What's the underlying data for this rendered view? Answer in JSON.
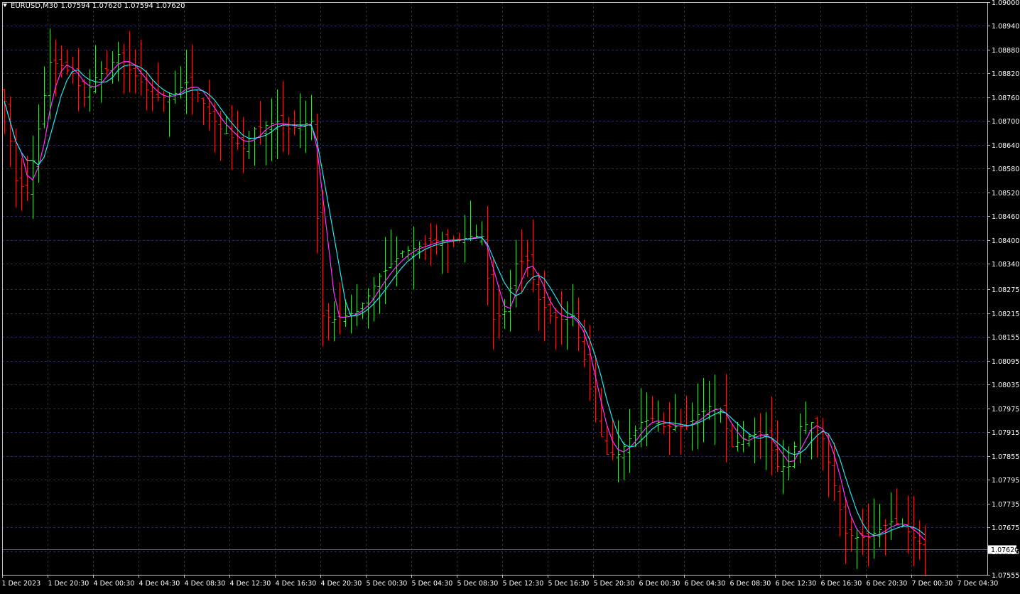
{
  "header": {
    "symbol": "EURUSD,M30",
    "quotes": "1.07594 1.07620 1.07594 1.07620"
  },
  "colors": {
    "background": "#000000",
    "grid": "#1e2a78",
    "frame": "#c0c0c0",
    "axis_text": "#ffffff",
    "bull": "#3fd73f",
    "bear": "#e02020",
    "ma_fast": "#ff33ff",
    "ma_slow": "#22e6f0",
    "price_line": "#5a5a5a"
  },
  "chart_data": {
    "type": "ohlc",
    "symbol": "EURUSD",
    "timeframe": "M30",
    "last_price_label": "1.07620",
    "ylim": [
      1.07555,
      1.09
    ],
    "y_ticks": [
      "1.09000",
      "1.08940",
      "1.08880",
      "1.08820",
      "1.08760",
      "1.08700",
      "1.08640",
      "1.08580",
      "1.08520",
      "1.08460",
      "1.08400",
      "1.08340",
      "1.08275",
      "1.08215",
      "1.08155",
      "1.08095",
      "1.08035",
      "1.07975",
      "1.07915",
      "1.07855",
      "1.07795",
      "1.07735",
      "1.07675",
      "1.07615",
      "1.07555"
    ],
    "x_labels": [
      "1 Dec 2023",
      "1 Dec 20:30",
      "4 Dec 00:30",
      "4 Dec 04:30",
      "4 Dec 08:30",
      "4 Dec 12:30",
      "4 Dec 16:30",
      "4 Dec 20:30",
      "5 Dec 00:30",
      "5 Dec 04:30",
      "5 Dec 08:30",
      "5 Dec 12:30",
      "5 Dec 16:30",
      "5 Dec 20:30",
      "6 Dec 00:30",
      "6 Dec 04:30",
      "6 Dec 08:30",
      "6 Dec 12:30",
      "6 Dec 16:30",
      "6 Dec 20:30",
      "7 Dec 00:30",
      "7 Dec 04:30"
    ],
    "bars_per_label": 8,
    "grid": true,
    "indicators": [
      "MA fast (magenta)",
      "MA slow (cyan)"
    ],
    "anchor_closes": [
      1.0875,
      1.0855,
      1.0852,
      1.0868,
      1.0885,
      1.0884,
      1.0882,
      1.0876,
      1.0881,
      1.0883,
      1.0887,
      1.0883,
      1.088,
      1.0876,
      1.0876,
      1.0877,
      1.088,
      1.0877,
      1.0872,
      1.0868,
      1.0866,
      1.0863,
      1.0868,
      1.0869,
      1.087,
      1.0868,
      1.0869,
      1.087,
      1.0821,
      1.082,
      1.0821,
      1.0822,
      1.0826,
      1.0831,
      1.0834,
      1.0837,
      1.0838,
      1.0839,
      1.084,
      1.084,
      1.084,
      1.0841,
      1.0841,
      1.082,
      1.0822,
      1.0834,
      1.0835,
      1.0825,
      1.0821,
      1.082,
      1.0821,
      1.081,
      1.0795,
      1.0786,
      1.0786,
      1.079,
      1.0794,
      1.0795,
      1.0793,
      1.0793,
      1.0793,
      1.0796,
      1.0798,
      1.0797,
      1.0788,
      1.079,
      1.0791,
      1.0791,
      1.0783,
      1.0783,
      1.0793,
      1.0794,
      1.079,
      1.0778,
      1.0766,
      1.0765,
      1.0765,
      1.0767,
      1.0769,
      1.0768,
      1.0765,
      1.0762
    ],
    "values_per_anchor": 2,
    "last_value": 1.0762
  }
}
